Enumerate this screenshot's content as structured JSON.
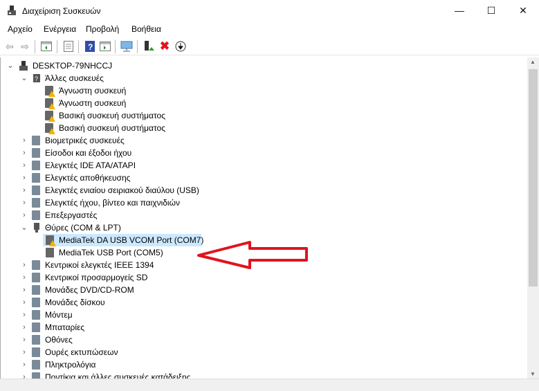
{
  "window": {
    "title": "Διαχείριση Συσκευών",
    "minimize": "—",
    "maximize": "☐",
    "close": "✕"
  },
  "menu": [
    "Αρχείο",
    "Ενέργεια",
    "Προβολή",
    "Βοήθεια"
  ],
  "tree": {
    "root": "DESKTOP-79NHCCJ",
    "other_devices": {
      "label": "Άλλες συσκευές",
      "children": [
        "Άγνωστη συσκευή",
        "Άγνωστη συσκευή",
        "Βασική συσκευή συστήματος",
        "Βασική συσκευή συστήματος"
      ]
    },
    "cats_a": [
      "Βιομετρικές συσκευές",
      "Είσοδοι και έξοδοι ήχου",
      "Ελεγκτές IDE ATA/ATAPI",
      "Ελεγκτές αποθήκευσης",
      "Ελεγκτές ενιαίου σειριακού διαύλου (USB)",
      "Ελεγκτές ήχου, βίντεο και παιχνιδιών",
      "Επεξεργαστές"
    ],
    "ports": {
      "label": "Θύρες (COM & LPT)",
      "children": [
        "MediaTek DA USB VCOM Port (COM7)",
        "MediaTek USB Port (COM5)"
      ]
    },
    "cats_b": [
      "Κεντρικοί ελεγκτές IEEE 1394",
      "Κεντρικοί προσαρμογείς SD",
      "Μονάδες DVD/CD-ROM",
      "Μονάδες δίσκου",
      "Μόντεμ",
      "Μπαταρίες",
      "Οθόνες",
      "Ουρές εκτυπώσεων",
      "Πληκτρολόγια",
      "Ποντίκια και άλλες συσκευές κατάδειξης"
    ]
  },
  "colors": {
    "selection": "#cce8ff",
    "arrow": "#e0141e"
  }
}
